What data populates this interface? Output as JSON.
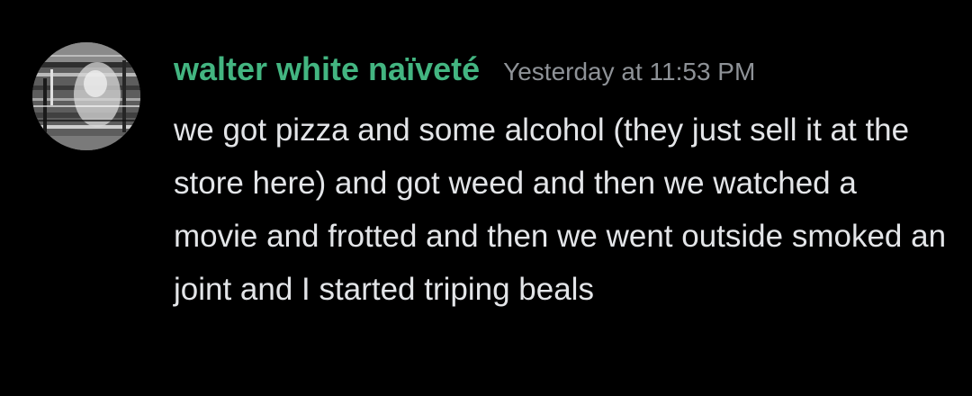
{
  "message": {
    "author": "walter white naïveté",
    "timestamp": "Yesterday at 11:53 PM",
    "text": "we got pizza and some alcohol (they just sell it at the store here) and got weed and then we watched a movie and frotted and then we went outside smoked an joint and I started triping beals",
    "author_color": "#43b581"
  },
  "avatar": {
    "icon": "user-avatar-image"
  }
}
